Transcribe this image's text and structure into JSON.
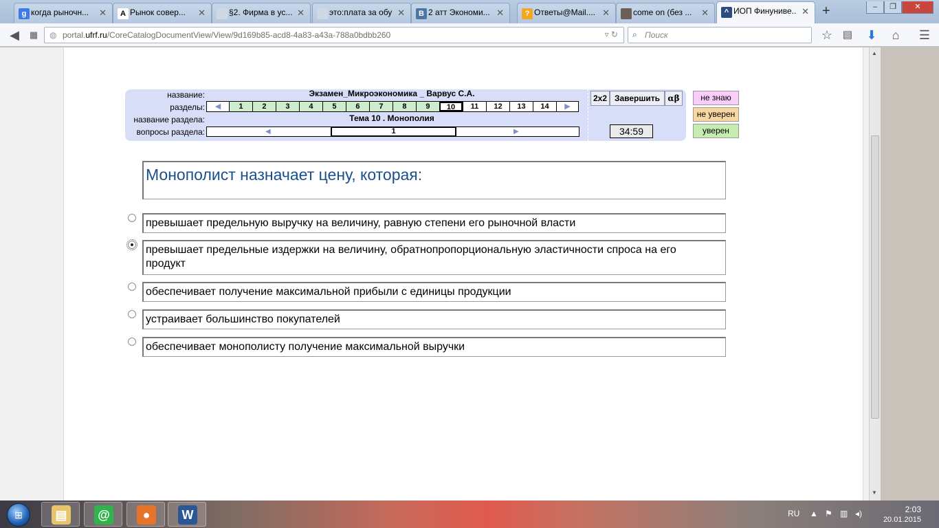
{
  "browser": {
    "tabs": [
      {
        "title": "когда рыночн...",
        "favicon": "google-icon",
        "color": "#3f7be6",
        "glyph": "g"
      },
      {
        "title": "Рынок совер...",
        "favicon": "a-icon",
        "color": "#ffffff",
        "glyph": "A"
      },
      {
        "title": "§2. Фирма в ус...",
        "favicon": "page-icon",
        "color": "#d0d8e4",
        "glyph": ""
      },
      {
        "title": "это:плата за обуч...",
        "favicon": "page-icon",
        "color": "#d0d8e4",
        "glyph": ""
      },
      {
        "title": "2 атт Экономи...",
        "favicon": "vk-icon",
        "color": "#4a76a8",
        "glyph": "B"
      },
      {
        "title": "Ответы@Mail....",
        "favicon": "question-icon",
        "color": "#f5a623",
        "glyph": "?"
      },
      {
        "title": "come on (без ...",
        "favicon": "image-icon",
        "color": "#6b5f5a",
        "glyph": ""
      },
      {
        "title": "ИОП Финуниве...",
        "favicon": "cap-icon",
        "color": "#2b4c7e",
        "glyph": "^"
      }
    ],
    "new_tab": "+",
    "window_buttons": {
      "minimize": "–",
      "restore": "❐",
      "close": "✕"
    },
    "url_prefix": "portal.",
    "url_host": "ufrf.ru",
    "url_path": "/CoreCatalogDocumentView/View/9d169b85-acd8-4a83-a43a-788a0bdbb260",
    "search_placeholder": "Поиск"
  },
  "exam": {
    "labels": {
      "name": "название:",
      "sections": "разделы:",
      "section_name": "название раздела:",
      "section_questions": "вопросы раздела:"
    },
    "title": "Экзамен_Микроэкономика _ Варвус С.А.",
    "sections": [
      "1",
      "2",
      "3",
      "4",
      "5",
      "6",
      "7",
      "8",
      "9",
      "10",
      "11",
      "12",
      "13",
      "14"
    ],
    "completed_sections": 9,
    "current_section": "10",
    "section_title": "Тема  10 . Монополия",
    "current_question": "1",
    "controls": {
      "size": "2x2",
      "finish": "Завершить",
      "alphabet": "αβ"
    },
    "timer": "34:59",
    "confidence": [
      {
        "label": "не знаю",
        "color": "#f9ccf9"
      },
      {
        "label": "не уверен",
        "color": "#f8d7a0"
      },
      {
        "label": "уверен",
        "color": "#c5ecb1"
      }
    ]
  },
  "question": {
    "text": "Монополист назначает цену, которая:",
    "selected_index": 1,
    "answers": [
      "превышает предельную выручку на величину, равную степени его рыночной власти",
      "превышает предельные издержки на величину, обратнопропорциональную эластичности спроса на его продукт",
      "обеспечивает получение максимальной прибыли с единицы продукции",
      "устраивает большинство покупателей",
      "обеспечивает монополисту получение максимальной выручки"
    ]
  },
  "taskbar": {
    "apps": [
      {
        "name": "explorer-icon",
        "glyph": "▤",
        "bg": "#e8c46a"
      },
      {
        "name": "mail-agent-icon",
        "glyph": "@",
        "bg": "#2fb34a"
      },
      {
        "name": "firefox-icon",
        "glyph": "●",
        "bg": "#e8742a"
      },
      {
        "name": "word-icon",
        "glyph": "W",
        "bg": "#2b5797"
      }
    ],
    "language": "RU",
    "time": "2:03",
    "date": "20.01.2015"
  }
}
